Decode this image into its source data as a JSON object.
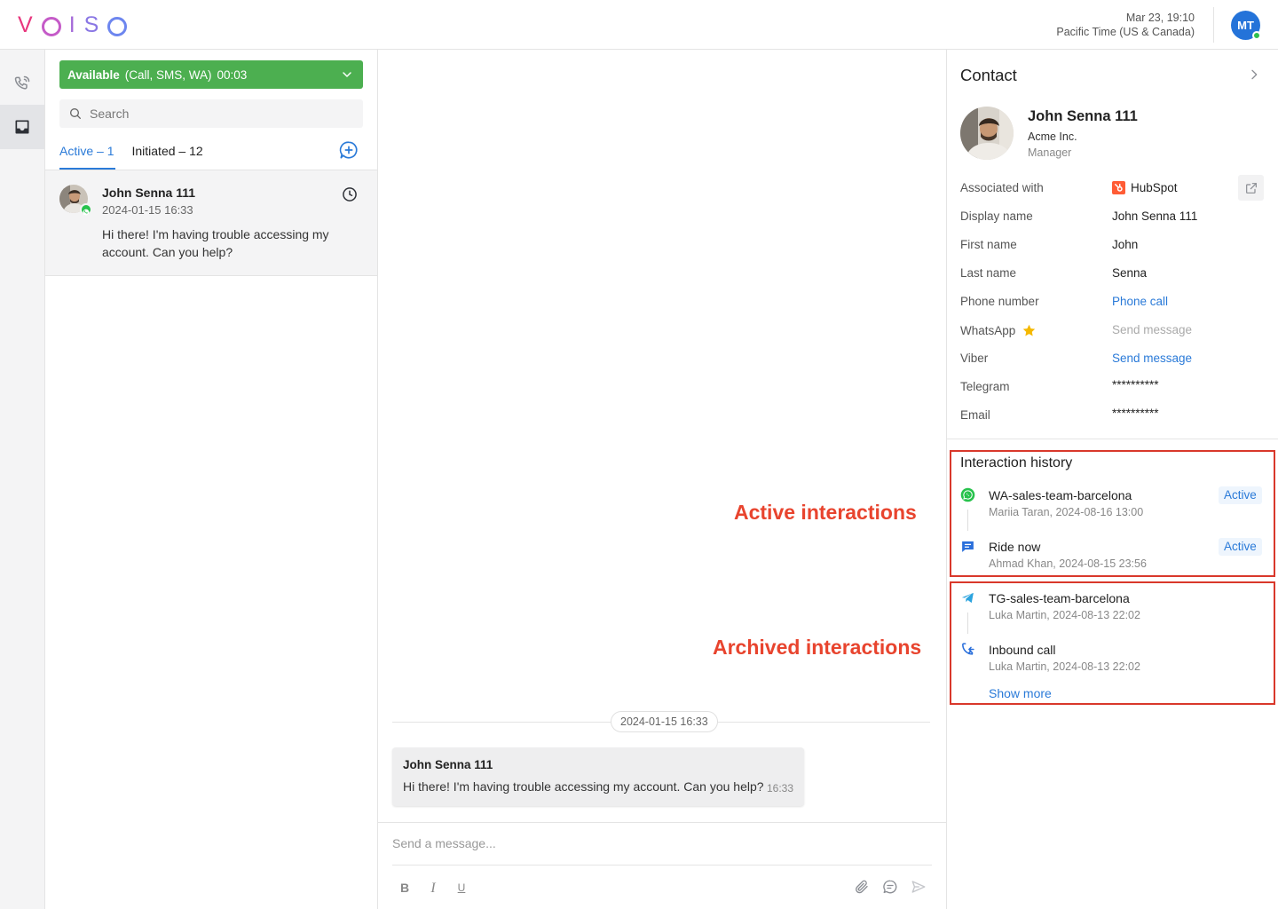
{
  "brand": {
    "logo_letters": [
      "V",
      "",
      "I",
      "S",
      ""
    ]
  },
  "header": {
    "date": "Mar 23, 19:10",
    "timezone": "Pacific Time (US & Canada)",
    "user_initials": "MT"
  },
  "status": {
    "state": "Available",
    "channels": "(Call, SMS, WA)",
    "timer": "00:03",
    "color": "#4caf50"
  },
  "search": {
    "placeholder": "Search"
  },
  "tabs": [
    {
      "label": "Active – 1",
      "active": true
    },
    {
      "label": "Initiated – 12",
      "active": false
    }
  ],
  "conversation": {
    "name": "John Senna 111",
    "timestamp": "2024-01-15 16:33",
    "preview": "Hi there! I'm having trouble accessing my account. Can you help?",
    "channel_icon": "whatsapp-icon"
  },
  "chat": {
    "date_separator": "2024-01-15 16:33",
    "message": {
      "sender": "John Senna 111",
      "text": "Hi there! I'm having trouble accessing my account. Can you help?",
      "time": "16:33"
    },
    "composer_placeholder": "Send a message...",
    "format_buttons": {
      "bold": "B",
      "italic": "I",
      "underline": "U"
    }
  },
  "annotations": {
    "active": "Active interactions",
    "archived": "Archived interactions"
  },
  "contact": {
    "title": "Contact",
    "name": "John Senna 111",
    "company": "Acme Inc.",
    "role": "Manager",
    "fields": {
      "associated_label": "Associated with",
      "associated_value": "HubSpot",
      "display_name_label": "Display name",
      "display_name_value": "John Senna 111",
      "first_name_label": "First name",
      "first_name_value": "John",
      "last_name_label": "Last name",
      "last_name_value": "Senna",
      "phone_label": "Phone number",
      "phone_value": "Phone call",
      "whatsapp_label": "WhatsApp",
      "whatsapp_value": "Send message",
      "viber_label": "Viber",
      "viber_value": "Send message",
      "telegram_label": "Telegram",
      "telegram_value": "**********",
      "email_label": "Email",
      "email_value": "**********"
    }
  },
  "interaction_history": {
    "title": "Interaction history",
    "items": [
      {
        "icon": "whatsapp-icon",
        "title": "WA-sales-team-barcelona",
        "subtitle": "Mariia Taran, 2024-08-16 13:00",
        "badge": "Active"
      },
      {
        "icon": "chat-icon",
        "title": "Ride now",
        "subtitle": "Ahmad Khan, 2024-08-15 23:56",
        "badge": "Active"
      },
      {
        "icon": "telegram-icon",
        "title": "TG-sales-team-barcelona",
        "subtitle": "Luka Martin, 2024-08-13 22:02"
      },
      {
        "icon": "inbound-call-icon",
        "title": "Inbound call",
        "subtitle": "Luka Martin, 2024-08-13 22:02"
      }
    ],
    "show_more": "Show more"
  }
}
